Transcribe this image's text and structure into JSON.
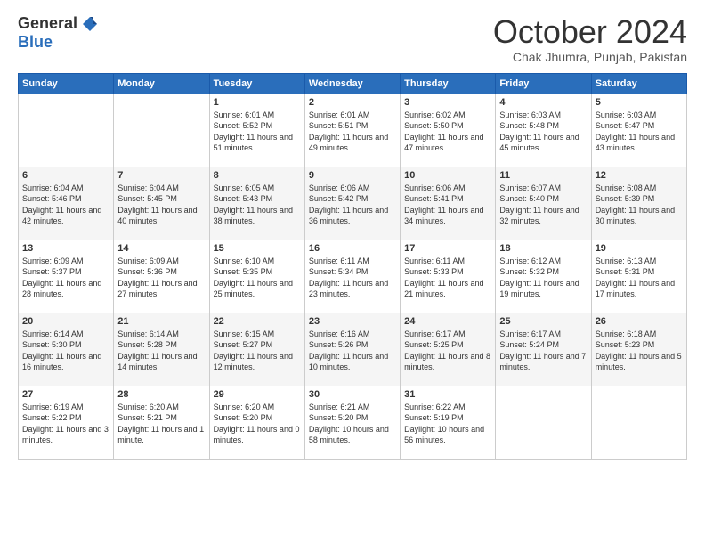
{
  "header": {
    "logo_general": "General",
    "logo_blue": "Blue",
    "month_title": "October 2024",
    "location": "Chak Jhumra, Punjab, Pakistan"
  },
  "days_of_week": [
    "Sunday",
    "Monday",
    "Tuesday",
    "Wednesday",
    "Thursday",
    "Friday",
    "Saturday"
  ],
  "weeks": [
    [
      {
        "day": "",
        "info": ""
      },
      {
        "day": "",
        "info": ""
      },
      {
        "day": "1",
        "info": "Sunrise: 6:01 AM\nSunset: 5:52 PM\nDaylight: 11 hours and 51 minutes."
      },
      {
        "day": "2",
        "info": "Sunrise: 6:01 AM\nSunset: 5:51 PM\nDaylight: 11 hours and 49 minutes."
      },
      {
        "day": "3",
        "info": "Sunrise: 6:02 AM\nSunset: 5:50 PM\nDaylight: 11 hours and 47 minutes."
      },
      {
        "day": "4",
        "info": "Sunrise: 6:03 AM\nSunset: 5:48 PM\nDaylight: 11 hours and 45 minutes."
      },
      {
        "day": "5",
        "info": "Sunrise: 6:03 AM\nSunset: 5:47 PM\nDaylight: 11 hours and 43 minutes."
      }
    ],
    [
      {
        "day": "6",
        "info": "Sunrise: 6:04 AM\nSunset: 5:46 PM\nDaylight: 11 hours and 42 minutes."
      },
      {
        "day": "7",
        "info": "Sunrise: 6:04 AM\nSunset: 5:45 PM\nDaylight: 11 hours and 40 minutes."
      },
      {
        "day": "8",
        "info": "Sunrise: 6:05 AM\nSunset: 5:43 PM\nDaylight: 11 hours and 38 minutes."
      },
      {
        "day": "9",
        "info": "Sunrise: 6:06 AM\nSunset: 5:42 PM\nDaylight: 11 hours and 36 minutes."
      },
      {
        "day": "10",
        "info": "Sunrise: 6:06 AM\nSunset: 5:41 PM\nDaylight: 11 hours and 34 minutes."
      },
      {
        "day": "11",
        "info": "Sunrise: 6:07 AM\nSunset: 5:40 PM\nDaylight: 11 hours and 32 minutes."
      },
      {
        "day": "12",
        "info": "Sunrise: 6:08 AM\nSunset: 5:39 PM\nDaylight: 11 hours and 30 minutes."
      }
    ],
    [
      {
        "day": "13",
        "info": "Sunrise: 6:09 AM\nSunset: 5:37 PM\nDaylight: 11 hours and 28 minutes."
      },
      {
        "day": "14",
        "info": "Sunrise: 6:09 AM\nSunset: 5:36 PM\nDaylight: 11 hours and 27 minutes."
      },
      {
        "day": "15",
        "info": "Sunrise: 6:10 AM\nSunset: 5:35 PM\nDaylight: 11 hours and 25 minutes."
      },
      {
        "day": "16",
        "info": "Sunrise: 6:11 AM\nSunset: 5:34 PM\nDaylight: 11 hours and 23 minutes."
      },
      {
        "day": "17",
        "info": "Sunrise: 6:11 AM\nSunset: 5:33 PM\nDaylight: 11 hours and 21 minutes."
      },
      {
        "day": "18",
        "info": "Sunrise: 6:12 AM\nSunset: 5:32 PM\nDaylight: 11 hours and 19 minutes."
      },
      {
        "day": "19",
        "info": "Sunrise: 6:13 AM\nSunset: 5:31 PM\nDaylight: 11 hours and 17 minutes."
      }
    ],
    [
      {
        "day": "20",
        "info": "Sunrise: 6:14 AM\nSunset: 5:30 PM\nDaylight: 11 hours and 16 minutes."
      },
      {
        "day": "21",
        "info": "Sunrise: 6:14 AM\nSunset: 5:28 PM\nDaylight: 11 hours and 14 minutes."
      },
      {
        "day": "22",
        "info": "Sunrise: 6:15 AM\nSunset: 5:27 PM\nDaylight: 11 hours and 12 minutes."
      },
      {
        "day": "23",
        "info": "Sunrise: 6:16 AM\nSunset: 5:26 PM\nDaylight: 11 hours and 10 minutes."
      },
      {
        "day": "24",
        "info": "Sunrise: 6:17 AM\nSunset: 5:25 PM\nDaylight: 11 hours and 8 minutes."
      },
      {
        "day": "25",
        "info": "Sunrise: 6:17 AM\nSunset: 5:24 PM\nDaylight: 11 hours and 7 minutes."
      },
      {
        "day": "26",
        "info": "Sunrise: 6:18 AM\nSunset: 5:23 PM\nDaylight: 11 hours and 5 minutes."
      }
    ],
    [
      {
        "day": "27",
        "info": "Sunrise: 6:19 AM\nSunset: 5:22 PM\nDaylight: 11 hours and 3 minutes."
      },
      {
        "day": "28",
        "info": "Sunrise: 6:20 AM\nSunset: 5:21 PM\nDaylight: 11 hours and 1 minute."
      },
      {
        "day": "29",
        "info": "Sunrise: 6:20 AM\nSunset: 5:20 PM\nDaylight: 11 hours and 0 minutes."
      },
      {
        "day": "30",
        "info": "Sunrise: 6:21 AM\nSunset: 5:20 PM\nDaylight: 10 hours and 58 minutes."
      },
      {
        "day": "31",
        "info": "Sunrise: 6:22 AM\nSunset: 5:19 PM\nDaylight: 10 hours and 56 minutes."
      },
      {
        "day": "",
        "info": ""
      },
      {
        "day": "",
        "info": ""
      }
    ]
  ]
}
